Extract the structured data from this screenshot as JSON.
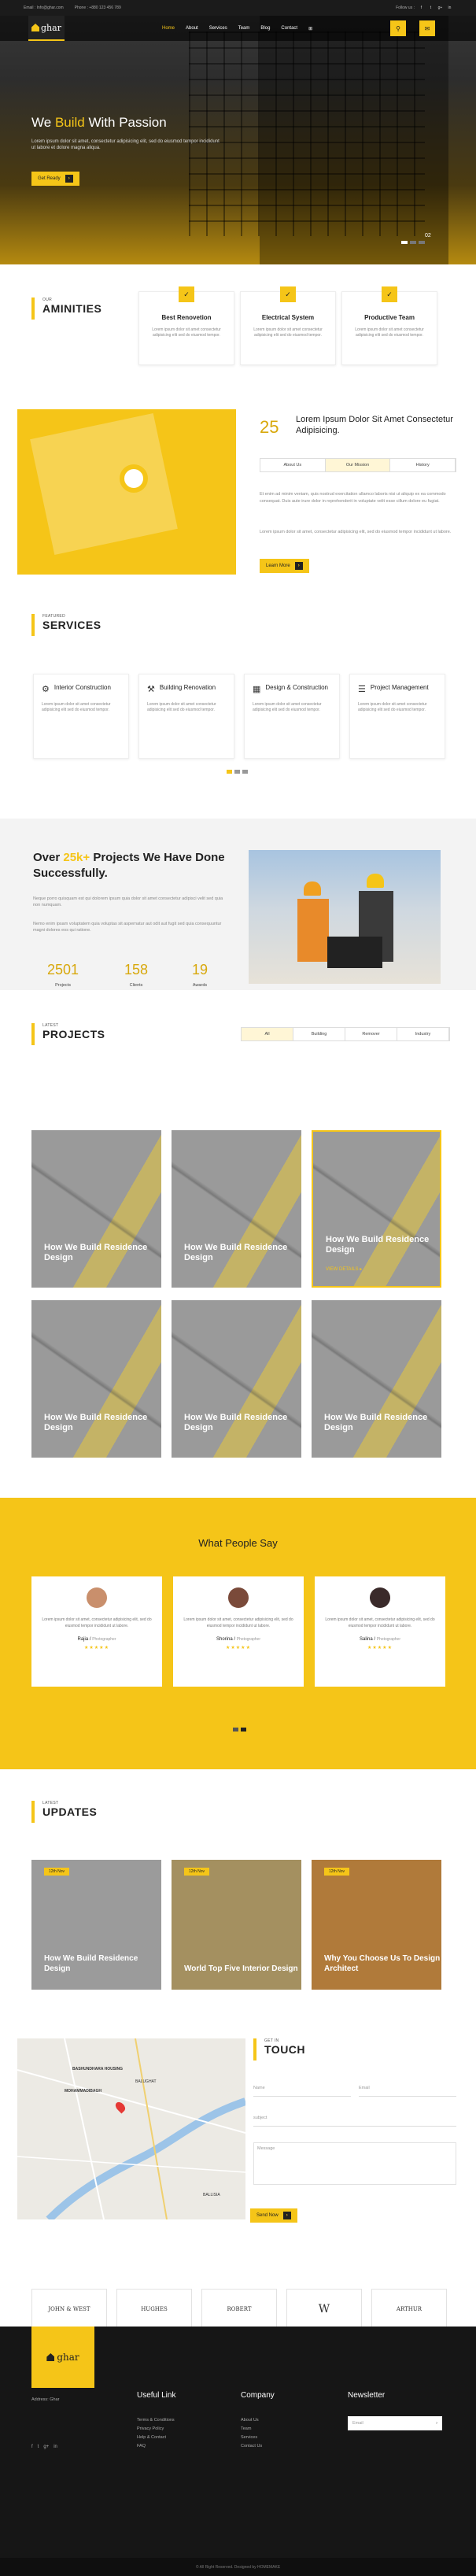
{
  "topbar": {
    "email": "Email : Info@ghar.com",
    "phone": "Phone : +880 123 456 789",
    "follow": "Follow us :",
    "social": [
      "f",
      "t",
      "g+",
      "in"
    ]
  },
  "nav": {
    "logo": "ghar",
    "menu": [
      "Home",
      "About",
      "Services",
      "Team",
      "Blog",
      "Contact"
    ],
    "grid_icon": "⊞",
    "search_icon": "⚲",
    "message_icon": "✉"
  },
  "hero": {
    "title_pre": "We",
    "title_accent": "Build",
    "title_post": "With Passion",
    "text": "Lorem ipsum dolor sit amet, consectetur adipisicing elit, sed do eiusmod tempor incididunt ut labore et dolore magna aliqua.",
    "button": "Get Ready",
    "slide_num": "02"
  },
  "amenities": {
    "small": "OUR",
    "big": "AMINITIES",
    "items": [
      {
        "title": "Best Renovetion",
        "text": "Lorem ipsum dolor sit amet consectetur adipisicing elit sed do eiusmod tempor."
      },
      {
        "title": "Electrical System",
        "text": "Lorem ipsum dolor sit amet consectetur adipisicing elit sed do eiusmod tempor."
      },
      {
        "title": "Productive Team",
        "text": "Lorem ipsum dolor sit amet consectetur adipisicing elit sed do eiusmod tempor."
      }
    ]
  },
  "about": {
    "num": "25",
    "heading": "Lorem Ipsum Dolor Sit Amet Consectetur Adipisicing.",
    "tabs": [
      "About Us",
      "Our Mission",
      "History"
    ],
    "para1": "Et enim ad minim veniam, quis nostrud exercitation ullamco laboris nisi ut aliquip ex ea commodo consequat. Duis aute irure dolor in reprehenderit in voluptate velit esse cillum dolore eu fugiat.",
    "para2": "Lorem ipsum dolor sit amet, consectetur adipisicing elit, sed do eiusmod tempor incididunt ut labore.",
    "button": "Learn More"
  },
  "services": {
    "small": "FEATURED",
    "big": "SERVICES",
    "items": [
      {
        "icon": "⚙",
        "title": "Interior Construction",
        "text": "Lorem ipsum dolor sit amet consectetur adipisicing elit sed do eiusmod tempor."
      },
      {
        "icon": "⚒",
        "title": "Building Renovation",
        "text": "Lorem ipsum dolor sit amet consectetur adipisicing elit sed do eiusmod tempor."
      },
      {
        "icon": "▦",
        "title": "Design & Construction",
        "text": "Lorem ipsum dolor sit amet consectetur adipisicing elit sed do eiusmod tempor."
      },
      {
        "icon": "☰",
        "title": "Project Management",
        "text": "Lorem ipsum dolor sit amet consectetur adipisicing elit sed do eiusmod tempor."
      }
    ]
  },
  "stats": {
    "title_pre": "Over",
    "title_accent": "25k+",
    "title_post": "Projects We Have Done Successfully.",
    "para1": "Neque porro quisquam est qui dolorem ipsum quia dolor sit amet consectetur adipisci velit sed quia non numquam.",
    "para2": "Nemo enim ipsam voluptatem quia voluptas sit aspernatur aut odit aut fugit sed quia consequuntur magni dolores eos qui ratione.",
    "items": [
      {
        "n": "2501",
        "l": "Projects"
      },
      {
        "n": "158",
        "l": "Clients"
      },
      {
        "n": "19",
        "l": "Awards"
      }
    ]
  },
  "projects": {
    "small": "LATEST",
    "big": "PROJECTS",
    "filters": [
      "All",
      "Building",
      "Remover",
      "Industry"
    ],
    "title": "How We Build Residence Design",
    "view": "VIEW DETAILS ▸"
  },
  "testimonials": {
    "title": "What People Say",
    "items": [
      {
        "text": "Lorem ipsum dolor sit amet, consectetur adipisicing elit, sed do eiusmod tempor incididunt ut labore.",
        "name": "Rajia",
        "role": "Photographer",
        "stars": "★★★★★"
      },
      {
        "text": "Lorem ipsum dolor sit amet, consectetur adipisicing elit, sed do eiusmod tempor incididunt ut labore.",
        "name": "Shorina",
        "role": "Photographer",
        "stars": "★★★★★"
      },
      {
        "text": "Lorem ipsum dolor sit amet, consectetur adipisicing elit, sed do eiusmod tempor incididunt ut labore.",
        "name": "Salina",
        "role": "Photographer",
        "stars": "★★★★★"
      }
    ]
  },
  "updates": {
    "small": "LATEST",
    "big": "UPDATES",
    "items": [
      {
        "date": "12th Nov",
        "title": "How We Build Residence Design"
      },
      {
        "date": "12th Nov",
        "title": "World Top Five Interior Design"
      },
      {
        "date": "12th Nov",
        "title": "Why You Choose Us To Design Architect"
      }
    ]
  },
  "contact": {
    "small": "GET IN",
    "big": "TOUCH",
    "name": "Name",
    "email": "Email",
    "subject": "subject",
    "message": "Message",
    "button": "Send Now",
    "map_labels": [
      "BASHUNDHARA HOUSING",
      "BALUGHAT",
      "MOHAMMADIBAGH",
      "BALLISIA"
    ]
  },
  "brands": [
    "JOHN & WEST",
    "HUGHES",
    "ROBERT",
    "W",
    "ARTHUR"
  ],
  "footer": {
    "logo": "ghar",
    "address": "Address: Ghar",
    "useful_title": "Useful Link",
    "useful": [
      "Terms & Conditions",
      "Privacy Policy",
      "Help & Contact",
      "FAQ"
    ],
    "company_title": "Company",
    "company": [
      "About Us",
      "Team",
      "Services",
      "Contact Us"
    ],
    "news_title": "Newsletter",
    "news_placeholder": "Email",
    "copyright": "© All Right Reserved. Designed by HOMEMAKE"
  }
}
